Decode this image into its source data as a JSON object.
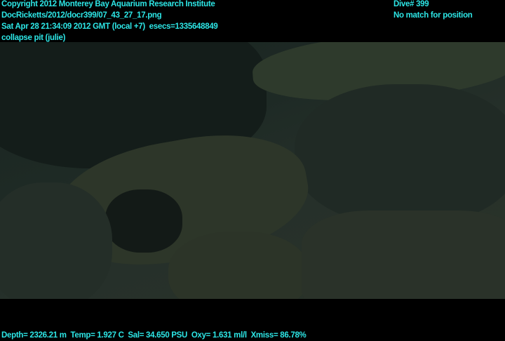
{
  "header": {
    "copyright": "Copyright 2012 Monterey Bay Aquarium Research Institute",
    "filename": "DocRicketts/2012/docr399/07_43_27_17.png",
    "timestamp": "Sat Apr 28 21:34:09 2012 GMT (local +7)  esecs=1335648849",
    "annotation": "collapse pit (julie)",
    "dive": "Dive# 399",
    "position": "No match for position"
  },
  "footer": {
    "sensors": "Depth= 2326.21 m  Temp= 1.927 C  Sal= 34.650 PSU  Oxy= 1.631 ml/l  Xmiss= 86.78%"
  }
}
